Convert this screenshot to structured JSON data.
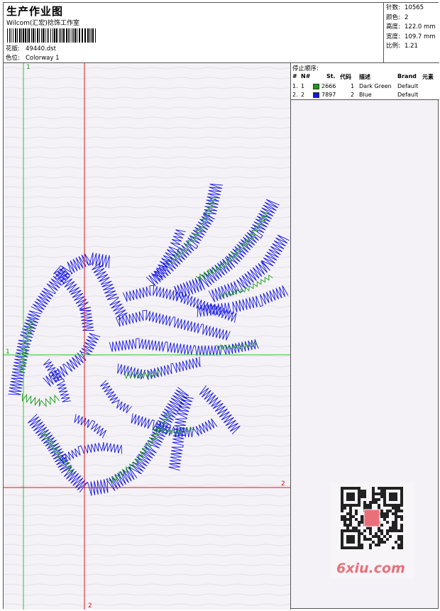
{
  "header": {
    "title": "生产作业图",
    "company": "Wilcom(汇宏)捻饰工作室",
    "design_label": "花版:",
    "design_value": "49440.dst",
    "colorway_label": "色位:",
    "colorway_value": "Colorway 1"
  },
  "stats": [
    {
      "label": "针数:",
      "value": "10565"
    },
    {
      "label": "颜色:",
      "value": "2"
    },
    {
      "label": "高度:",
      "value": "122.0 mm"
    },
    {
      "label": "宽度:",
      "value": "109.7 mm"
    },
    {
      "label": "比例:",
      "value": "1.21"
    }
  ],
  "stop_sequence": {
    "title": "停止顺序:",
    "columns": [
      "#",
      "N#",
      "St.",
      "代码",
      "描述",
      "Brand",
      "元素"
    ],
    "rows": [
      {
        "index": "1.",
        "n": "1",
        "st": "2666",
        "code": "1",
        "desc": "Dark Green",
        "brand": "Default",
        "color": "#1a9a1a"
      },
      {
        "index": "2.",
        "n": "2",
        "st": "7897",
        "code": "2",
        "desc": "Blue",
        "brand": "Default",
        "color": "#1414e6"
      }
    ]
  },
  "guides": {
    "vertical_green_label": "1",
    "horizontal_green_label": "1",
    "vertical_red_label": "2",
    "horizontal_red_label": "2"
  },
  "colors": {
    "green_thread": "#1a9a1a",
    "blue_thread": "#1414e6",
    "green_guide": "#22cc22",
    "red_guide": "#d81818"
  },
  "watermark": {
    "text": "6xiu.com"
  }
}
